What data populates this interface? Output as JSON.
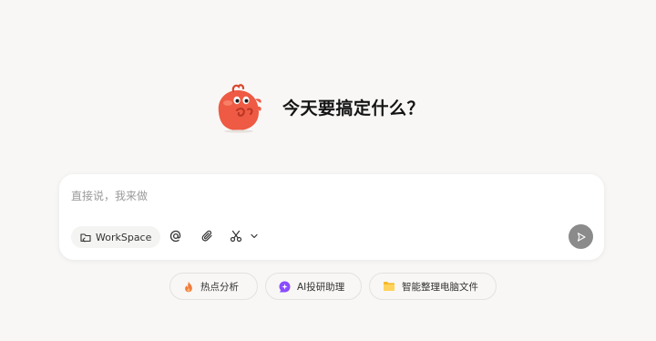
{
  "hero": {
    "title": "今天要搞定什么？",
    "mascot_icon": "red-blob-mascot"
  },
  "composer": {
    "placeholder": "直接说，我来做",
    "workspace_label": "WorkSpace",
    "tools": [
      "at-icon",
      "paperclip-icon",
      "scissors-icon",
      "chevron-down-icon"
    ],
    "send_icon": "send-icon"
  },
  "suggestions": [
    {
      "label": "热点分析",
      "icon": "fire-icon",
      "color": "#f07a3a"
    },
    {
      "label": "AI投研助理",
      "icon": "ai-sparkle-icon",
      "color": "#8a4dff"
    },
    {
      "label": "智能整理电脑文件",
      "icon": "folder-icon",
      "color": "#f5b92a"
    }
  ],
  "colors": {
    "background": "#f8f7f5",
    "mascot": "#ee5a43",
    "send_button": "#8b8b8b"
  }
}
